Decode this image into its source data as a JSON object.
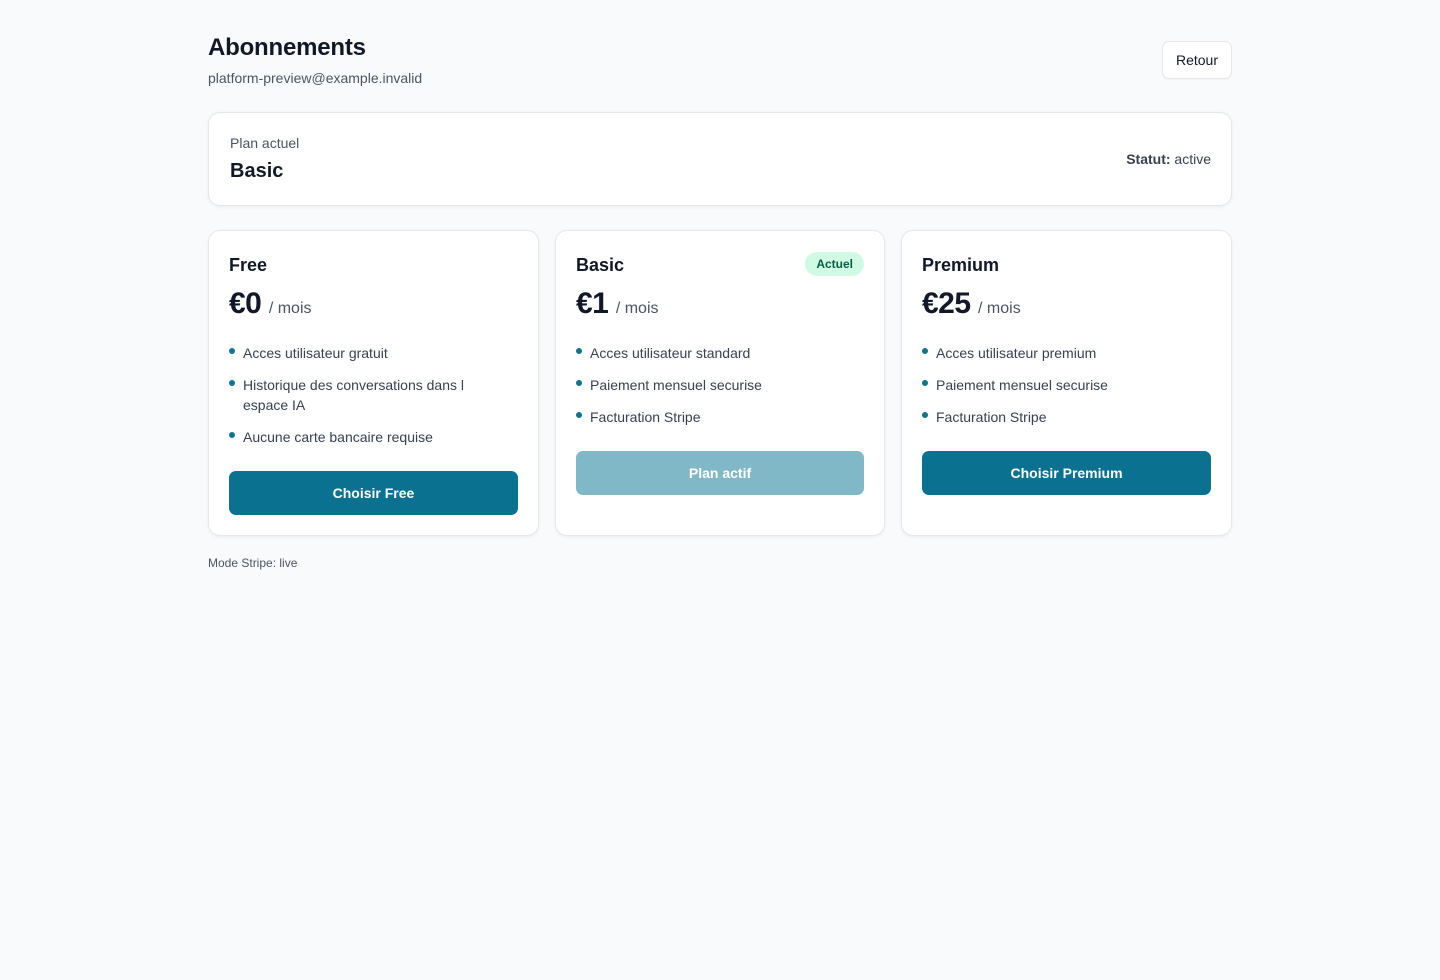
{
  "header": {
    "title": "Abonnements",
    "email": "platform-preview@example.invalid",
    "back_label": "Retour"
  },
  "current_plan": {
    "label": "Plan actuel",
    "name": "Basic",
    "status_key": "Statut:",
    "status_value": "active"
  },
  "plans": [
    {
      "name": "Free",
      "price": "€0",
      "period": "/ mois",
      "features": [
        "Acces utilisateur gratuit",
        "Historique des conversations dans l espace IA",
        "Aucune carte bancaire requise"
      ],
      "button_label": "Choisir Free"
    },
    {
      "name": "Basic",
      "badge": "Actuel",
      "price": "€1",
      "period": "/ mois",
      "features": [
        "Acces utilisateur standard",
        "Paiement mensuel securise",
        "Facturation Stripe"
      ],
      "button_label": "Plan actif"
    },
    {
      "name": "Premium",
      "price": "€25",
      "period": "/ mois",
      "features": [
        "Acces utilisateur premium",
        "Paiement mensuel securise",
        "Facturation Stripe"
      ],
      "button_label": "Choisir Premium"
    }
  ],
  "footer": {
    "stripe_mode": "Mode Stripe: live"
  },
  "colors": {
    "primary": "#0a7190",
    "primary_disabled": "#80b8c8",
    "badge_bg": "#d1fae5",
    "badge_text": "#065f46",
    "bullet": "#0e7490",
    "background": "#f9fafb"
  }
}
